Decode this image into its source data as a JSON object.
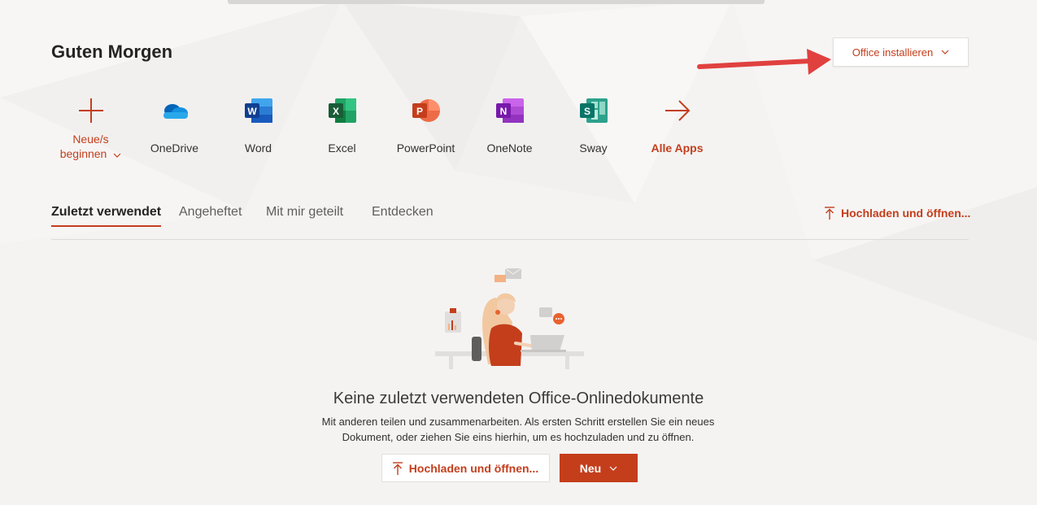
{
  "header": {
    "greeting": "Guten Morgen",
    "install_label": "Office installieren"
  },
  "apps": [
    {
      "label": "Neue/s beginnen",
      "icon": "plus-icon"
    },
    {
      "label": "OneDrive",
      "icon": "onedrive-icon"
    },
    {
      "label": "Word",
      "icon": "word-icon"
    },
    {
      "label": "Excel",
      "icon": "excel-icon"
    },
    {
      "label": "PowerPoint",
      "icon": "powerpoint-icon"
    },
    {
      "label": "OneNote",
      "icon": "onenote-icon"
    },
    {
      "label": "Sway",
      "icon": "sway-icon"
    },
    {
      "label": "Alle Apps",
      "icon": "arrow-right-icon"
    }
  ],
  "new_doc": {
    "line1": "Neue/s",
    "line2": "beginnen"
  },
  "tabs": [
    {
      "label": "Zuletzt verwendet",
      "active": true
    },
    {
      "label": "Angeheftet",
      "active": false
    },
    {
      "label": "Mit mir geteilt",
      "active": false
    },
    {
      "label": "Entdecken",
      "active": false
    }
  ],
  "upload_link_label": "Hochladen und öffnen...",
  "empty_state": {
    "title": "Keine zuletzt verwendeten Office-Onlinedokumente",
    "description_line1": "Mit anderen teilen und zusammenarbeiten. Als ersten Schritt erstellen Sie ein neues",
    "description_line2": "Dokument, oder ziehen Sie eins hierhin, um es hochzuladen und zu öffnen.",
    "upload_button": "Hochladen und öffnen...",
    "new_button": "Neu"
  },
  "colors": {
    "accent": "#c43e1c",
    "background": "#f4f3f2",
    "annotation_arrow": "#e0413f"
  }
}
